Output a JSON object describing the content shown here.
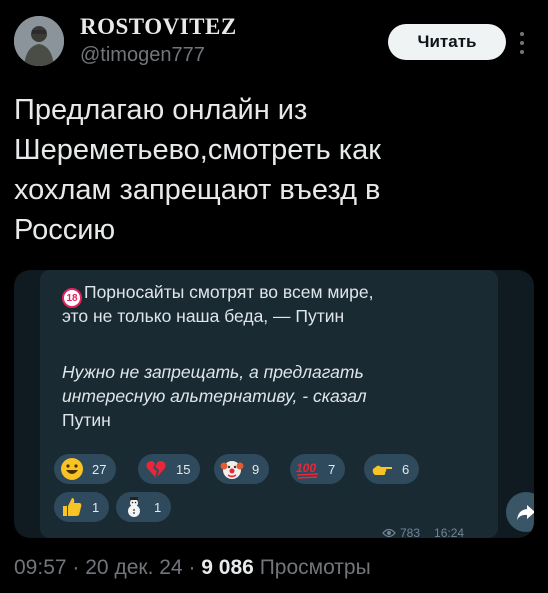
{
  "author": {
    "display_name": "ROSTOVITEZ",
    "handle": "@timogen777",
    "follow_label": "Читать"
  },
  "tweet": {
    "lines": [
      "Предлагаю онлайн из",
      "Шереметьево,смотреть как",
      "хохлам запрещают въезд в",
      "Россию"
    ]
  },
  "telegram_post": {
    "badge": "18",
    "line1": "Порносайты смотрят во всем мире,",
    "line2": "это не только наша беда, — Путин",
    "quote_line1": "Нужно не запрещать, а предлагать",
    "quote_line2": "интересную альтернативу, - сказал",
    "quote_line3": "Путин",
    "reactions": [
      {
        "icon": "grinning-face-icon",
        "count": "27"
      },
      {
        "icon": "broken-heart-icon",
        "count": "15"
      },
      {
        "icon": "clown-face-icon",
        "count": "9"
      },
      {
        "icon": "hundred-points-icon",
        "count": "7"
      },
      {
        "icon": "pointing-hand-icon",
        "count": "6"
      },
      {
        "icon": "thumbs-up-icon",
        "count": "1"
      },
      {
        "icon": "snowman-icon",
        "count": "1"
      }
    ],
    "views": "783",
    "time": "16:24"
  },
  "footer": {
    "time": "09:57",
    "sep1": "·",
    "date": "20 дек. 24",
    "sep2": "·",
    "views_count": "9 086",
    "views_label": "Просмотры"
  },
  "colors": {
    "background": "#000000",
    "text": "#e7e9ea",
    "muted": "#71767b",
    "telegram_bubble": "#1a2a33",
    "reaction_pill": "#2e4a5c"
  }
}
